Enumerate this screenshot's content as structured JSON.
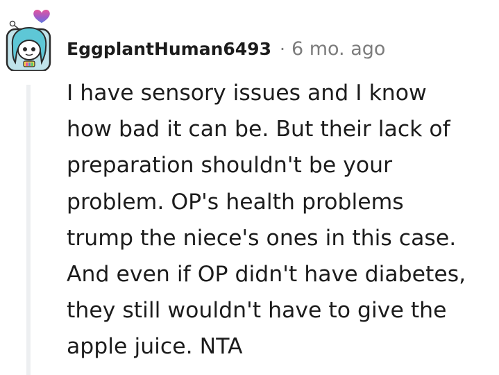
{
  "comment": {
    "username": "EggplantHuman6493",
    "separator": "·",
    "timestamp": "6 mo. ago",
    "avatar_icon": "snoo-avatar-icon",
    "badge_icon": "heart-icon",
    "body_lines": [
      "I have sensory issues and I know",
      "how bad it can be. But their lack of",
      "preparation shouldn't be your",
      "problem. OP's health problems",
      "trump the niece's ones in this case.",
      "And even if OP didn't have diabetes,",
      "they still wouldn't have to give the",
      "apple juice. NTA"
    ]
  },
  "colors": {
    "text": "#1c1c1c",
    "meta": "#7c7c7c",
    "thread_line": "#edeff1",
    "avatar_bg": "#c0e3ea",
    "avatar_hair": "#5ec7d6",
    "heart_pink": "#e8569a",
    "heart_blue": "#5a7fe0"
  }
}
